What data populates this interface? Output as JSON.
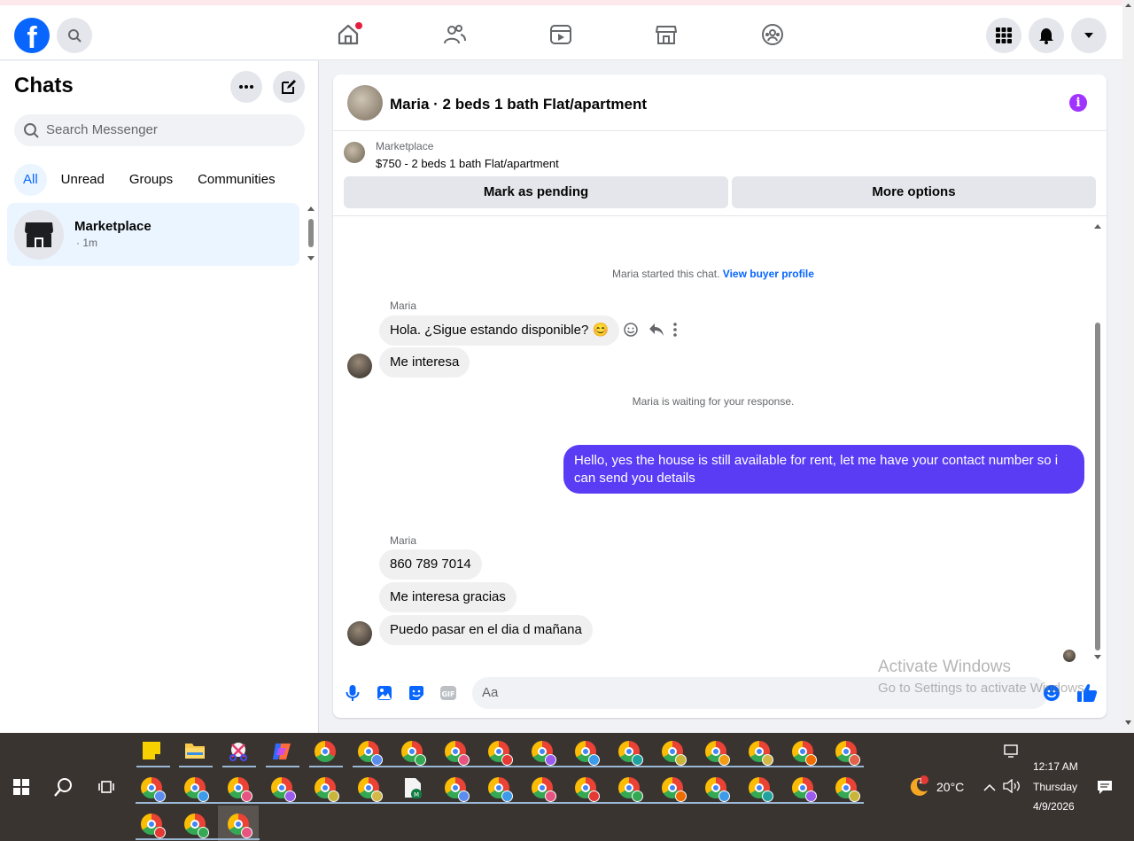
{
  "topnav": {
    "logo": "f",
    "icons": [
      "facebook-logo-icon",
      "search-icon",
      "home-icon",
      "friends-icon",
      "video-icon",
      "marketplace-icon",
      "groups-icon",
      "menu-grid-icon",
      "bell-icon",
      "account-chevron-icon"
    ]
  },
  "sidebar": {
    "title": "Chats",
    "search_placeholder": "Search Messenger",
    "filters": [
      "All",
      "Unread",
      "Groups",
      "Communities"
    ],
    "chat": {
      "name": "Marketplace",
      "time": "· 1m"
    }
  },
  "conversation": {
    "title": "Maria · 2 beds 1 bath Flat/apartment",
    "marketplace_label": "Marketplace",
    "listing": "$750 - 2 beds 1 bath Flat/apartment",
    "mark_pending": "Mark as pending",
    "more_options": "More options",
    "started_text": "Maria started this chat.",
    "buyer_profile_link": "View buyer profile",
    "sender_name": "Maria",
    "msg1": "Hola. ¿Sigue estando disponible? 😊",
    "msg2": "Me interesa",
    "waiting_text": "Maria is waiting for your response.",
    "outgoing": "Hello, yes the house is still available for rent, let me have your contact number so i can send you details",
    "msg3": "860 789 7014",
    "msg4": "Me interesa gracias",
    "msg5": "Puedo pasar en el dia d mañana",
    "composer_placeholder": "Aa"
  },
  "watermark": {
    "line1": "Activate Windows",
    "line2": "Go to Settings to activate Windows."
  },
  "taskbar": {
    "weather_temp": "20°C",
    "weather_badge": "1",
    "time": "12:17 AM",
    "day": "Thursday",
    "date": "4/9/2026"
  },
  "colors": {
    "accent": "#0866ff",
    "outgoing_bubble": "#5b3cf5",
    "info_icon": "#a033ff"
  }
}
